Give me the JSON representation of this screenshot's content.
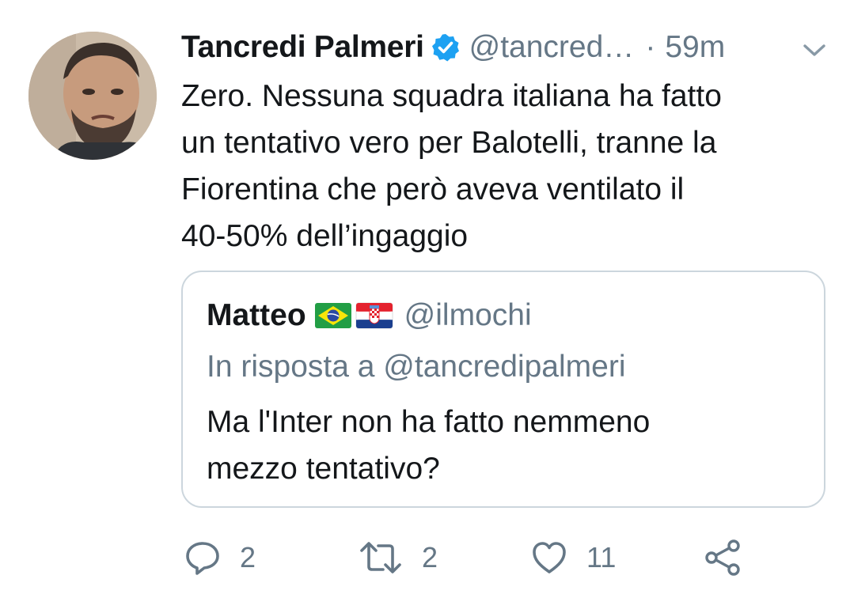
{
  "author": {
    "display_name": "Tancredi Palmeri",
    "handle": "@tancred…",
    "separator": "·",
    "time": "59m",
    "verified": true
  },
  "tweet": {
    "lines": [
      "Zero. Nessuna squadra italiana ha fatto",
      "un tentativo vero per Balotelli, tranne la",
      "Fiorentina che però aveva ventilato il",
      "40-50% dell’ingaggio"
    ]
  },
  "quoted_tweet": {
    "display_name": "Matteo",
    "flags": [
      "flag-brazil-icon",
      "flag-croatia-icon"
    ],
    "handle": "@ilmochi",
    "reply_to": "In risposta a @tancredipalmeri",
    "lines": [
      "Ma l'Inter non ha fatto nemmeno",
      "mezzo tentativo?"
    ]
  },
  "actions": {
    "reply_count": "2",
    "retweet_count": "2",
    "like_count": "11"
  },
  "colors": {
    "text": "#14171a",
    "secondary": "#657786",
    "verified_blue": "#1da1f2",
    "border": "#ccd6dd"
  }
}
